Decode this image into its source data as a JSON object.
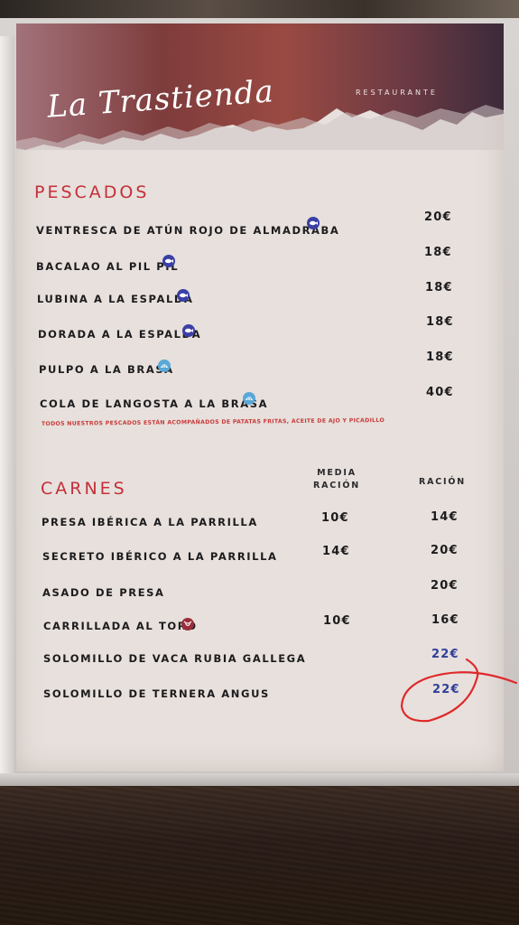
{
  "header": {
    "brand": "La Trastienda",
    "brand_sub": "RESTAURANTE"
  },
  "pescados": {
    "title": "PESCADOS",
    "items": [
      {
        "name": "VENTRESCA DE ATÚN ROJO DE ALMADRABA",
        "price": "20€",
        "icon": "fish-icon"
      },
      {
        "name": "BACALAO AL PIL PIL",
        "price": "18€",
        "icon": "fish-icon"
      },
      {
        "name": "LUBINA A LA ESPALDA",
        "price": "18€",
        "icon": "fish-icon"
      },
      {
        "name": "DORADA A LA ESPALDA",
        "price": "18€",
        "icon": "fish-icon"
      },
      {
        "name": "PULPO A LA BRASA",
        "price": "18€",
        "icon": "shell-icon"
      },
      {
        "name": "COLA DE LANGOSTA A LA BRASA",
        "price": "40€",
        "icon": "shell-icon"
      }
    ],
    "note": "TODOS NUESTROS PESCADOS ESTÁN ACOMPAÑADOS DE PATATAS FRITAS, ACEITE DE AJO Y PICADILLO"
  },
  "carnes": {
    "title": "CARNES",
    "col_media_1": "MEDIA",
    "col_media_2": "RACIÓN",
    "col_racion": "RACIÓN",
    "items": [
      {
        "name": "PRESA IBÉRICA A LA PARRILLA",
        "media": "10€",
        "racion": "14€"
      },
      {
        "name": "SECRETO IBÉRICO A LA PARRILLA",
        "media": "14€",
        "racion": "20€"
      },
      {
        "name": "ASADO DE PRESA",
        "media": "",
        "racion": "20€"
      },
      {
        "name": "CARRILLADA AL TORO",
        "media": "10€",
        "racion": "16€",
        "icon": "bull-icon"
      },
      {
        "name": "SOLOMILLO DE VACA RUBIA GALLEGA",
        "media": "",
        "racion": "22€"
      },
      {
        "name": "SOLOMILLO DE TERNERA ANGUS",
        "media": "",
        "racion": "22€"
      }
    ]
  },
  "colors": {
    "accent_red": "#c4303a",
    "fish_icon": "#3b3fa6",
    "shell_icon": "#5aa8d8",
    "marker_red": "#e0282a"
  }
}
